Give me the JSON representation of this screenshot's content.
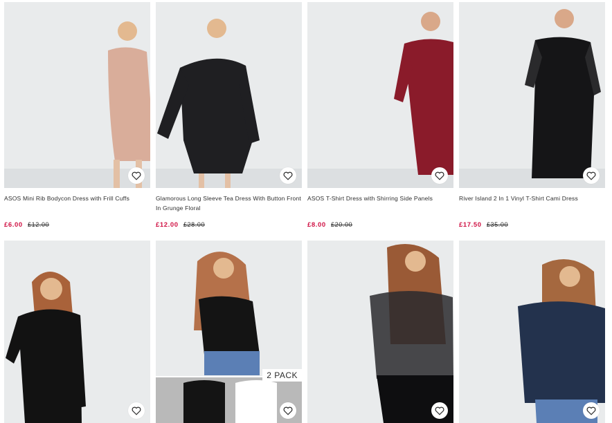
{
  "products": [
    {
      "title": "ASOS Mini Rib Bodycon Dress with Frill Cuffs",
      "price": "£6.00",
      "was": "£12.00",
      "garment_color": "#d9ad9a"
    },
    {
      "title": "Glamorous Long Sleeve Tea Dress With Button Front In Grunge Floral",
      "price": "£12.00",
      "was": "£28.00",
      "garment_color": "#1f1f22"
    },
    {
      "title": "ASOS T-Shirt Dress with Shirring Side Panels",
      "price": "£8.00",
      "was": "£20.00",
      "garment_color": "#8a1b2a"
    },
    {
      "title": "River Island 2 In 1 Vinyl T-Shirt Cami Dress",
      "price": "£17.50",
      "was": "£35.00",
      "garment_color": "#151517"
    },
    {
      "title": "",
      "price": "",
      "was": "",
      "garment_color": "#121212"
    },
    {
      "title": "",
      "price": "",
      "was": "",
      "garment_color": "#141414",
      "badge": "2 PACK"
    },
    {
      "title": "",
      "price": "",
      "was": "",
      "garment_color": "#1a1a1a"
    },
    {
      "title": "",
      "price": "",
      "was": "",
      "garment_color": "#23324d"
    }
  ],
  "icons": {
    "save": "heart-icon"
  },
  "colors": {
    "price_now": "#d01345",
    "text": "#2d2d2d"
  }
}
